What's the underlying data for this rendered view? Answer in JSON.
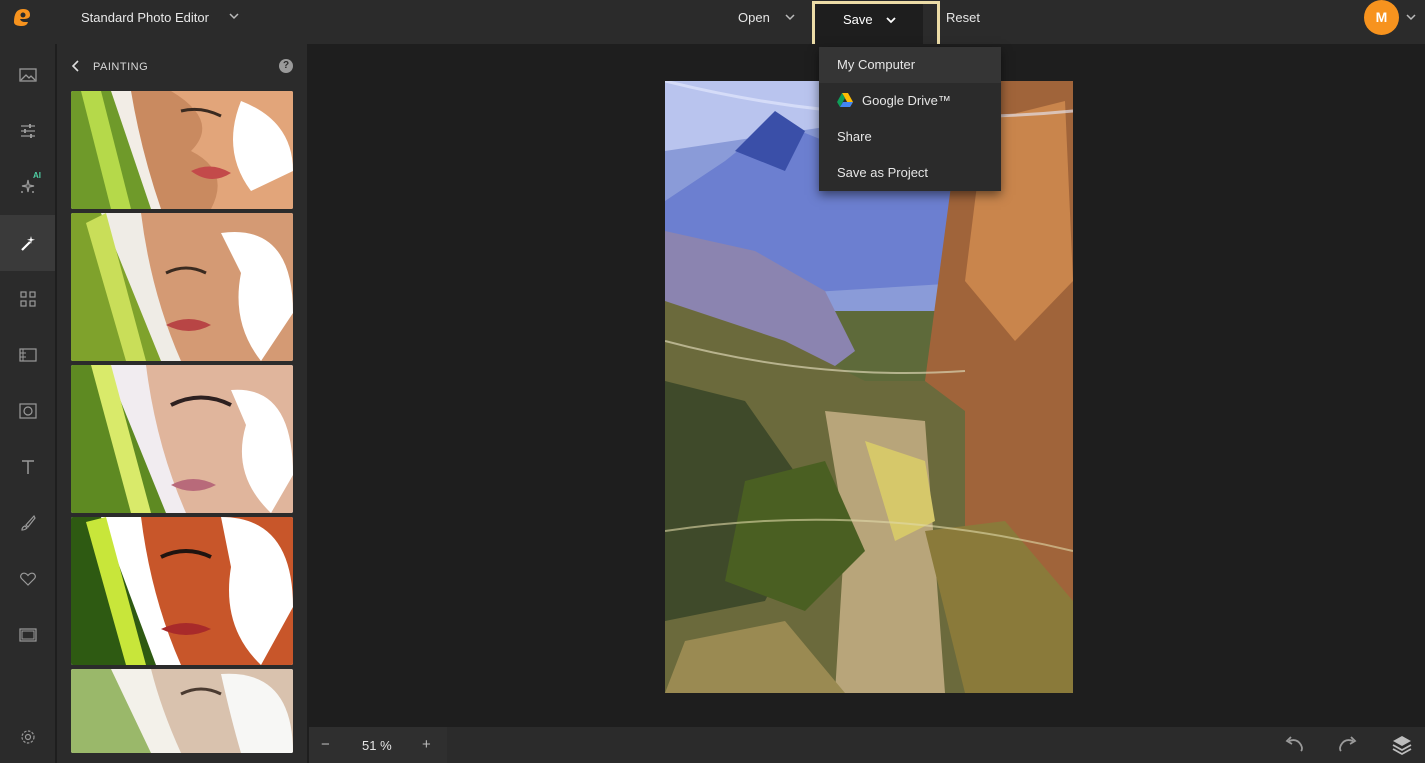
{
  "header": {
    "editor_name": "Standard Photo Editor",
    "open_label": "Open",
    "save_label": "Save",
    "reset_label": "Reset",
    "avatar_initial": "M"
  },
  "sidebar": {
    "items": [
      {
        "name": "image-icon"
      },
      {
        "name": "adjust-sliders-icon"
      },
      {
        "name": "ai-sparkle-icon",
        "badge": "AI"
      },
      {
        "name": "magic-wand-icon",
        "active": true
      },
      {
        "name": "grid-icon"
      },
      {
        "name": "texture-icon"
      },
      {
        "name": "frame-icon"
      },
      {
        "name": "text-icon"
      },
      {
        "name": "brush-icon"
      },
      {
        "name": "heart-icon"
      },
      {
        "name": "layout-icon"
      }
    ],
    "settings_icon": "gear-icon"
  },
  "panel": {
    "title": "PAINTING",
    "help": "?",
    "thumbnails": [
      "painting-effect-1",
      "painting-effect-2",
      "painting-effect-3",
      "painting-effect-4",
      "painting-effect-5"
    ]
  },
  "save_menu": {
    "items": [
      "My Computer",
      "Google Drive™",
      "Share",
      "Save as Project"
    ]
  },
  "footer": {
    "zoom_minus": "−",
    "zoom_value": "51 %",
    "zoom_plus": "+"
  },
  "colors": {
    "accent_orange": "#f7931e",
    "save_highlight": "#ecdca7",
    "bg_dark": "#1e1e1e",
    "panel_bg": "#2b2b2b"
  }
}
